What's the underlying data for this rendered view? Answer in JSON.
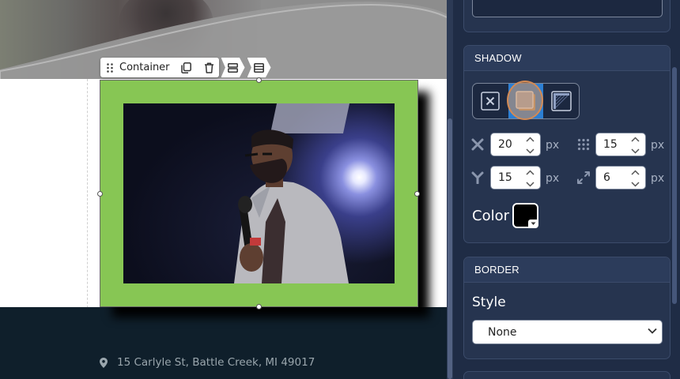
{
  "canvas": {
    "element_toolbar": {
      "label": "Container",
      "icons": [
        "drag-handle-icon",
        "duplicate-icon",
        "delete-icon",
        "rows-layout-icon",
        "list-layout-icon"
      ]
    },
    "footer": {
      "address": "15 Carlyle St, Battle Creek, MI 49017",
      "address_icon": "location-pin-icon"
    },
    "container_background": "#87c654"
  },
  "inspector": {
    "shadow": {
      "header": "SHADOW",
      "types": [
        {
          "name": "none",
          "icon": "no-shadow-icon",
          "active": false
        },
        {
          "name": "drop",
          "icon": "drop-shadow-icon",
          "active": true
        },
        {
          "name": "inner",
          "icon": "inner-shadow-icon",
          "active": false
        }
      ],
      "x": {
        "value": "20",
        "unit": "px"
      },
      "blur": {
        "value": "15",
        "unit": "px"
      },
      "y": {
        "value": "15",
        "unit": "px"
      },
      "spread": {
        "value": "6",
        "unit": "px"
      },
      "color_label": "Color",
      "color": "#000000"
    },
    "border": {
      "header": "BORDER",
      "style_label": "Style",
      "style_value": "None"
    }
  },
  "colors": {
    "panel_bg": "#1f2c45",
    "card_bg": "#26344f",
    "accent": "#2c7fd3",
    "footer_bg": "#0f1f2b"
  }
}
